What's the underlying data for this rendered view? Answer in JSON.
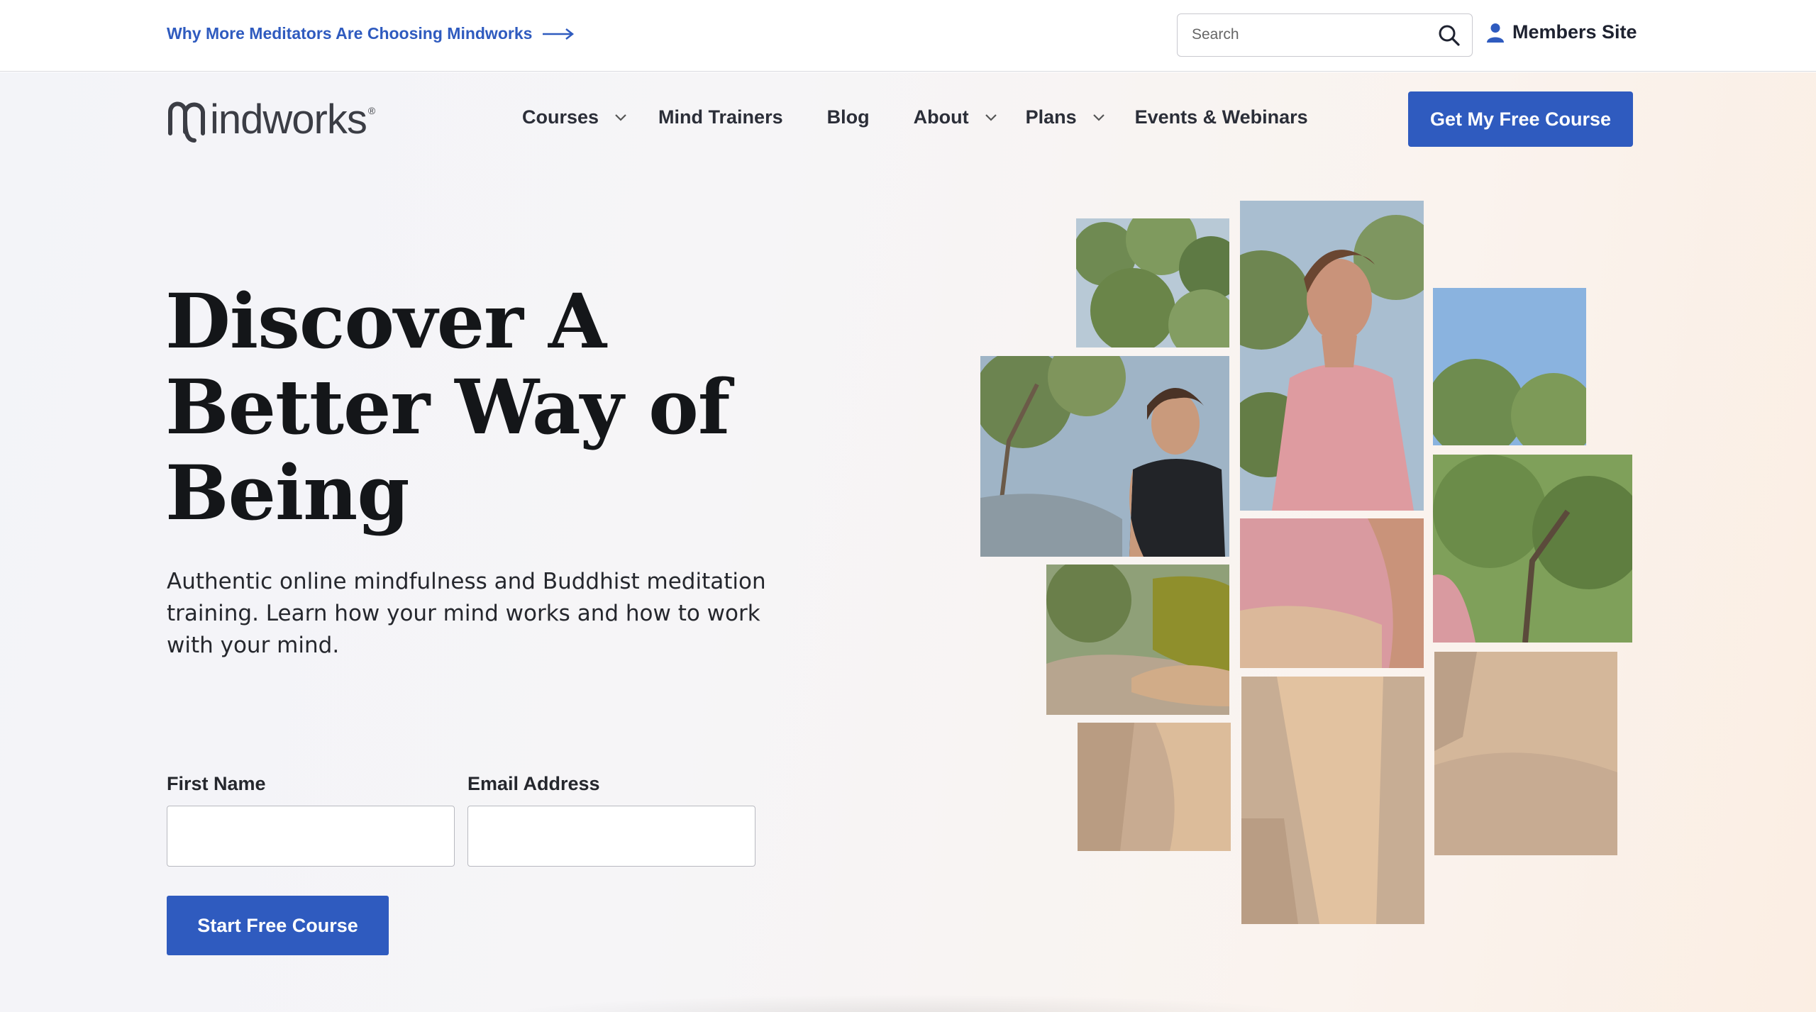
{
  "topbar": {
    "promo_text": "Why More Meditators Are Choosing Mindworks",
    "search_placeholder": "Search",
    "members_label": "Members Site"
  },
  "nav": {
    "logo_text": "indworks",
    "logo_mark": "®",
    "items": [
      {
        "label": "Courses",
        "has_dropdown": true
      },
      {
        "label": "Mind Trainers",
        "has_dropdown": false
      },
      {
        "label": "Blog",
        "has_dropdown": false
      },
      {
        "label": "About",
        "has_dropdown": true
      },
      {
        "label": "Plans",
        "has_dropdown": true
      },
      {
        "label": "Events & Webinars",
        "has_dropdown": false
      }
    ],
    "cta_label": "Get My Free Course"
  },
  "hero": {
    "headline_lines": [
      "Discover A",
      "Better Way of",
      "Being"
    ],
    "subtext": "Authentic online mindfulness and Buddhist meditation training. Learn how your mind works and how to work with your mind.",
    "first_name_label": "First Name",
    "email_label": "Email Address",
    "first_name_value": "",
    "email_value": "",
    "submit_label": "Start Free Course"
  },
  "colors": {
    "brand_blue": "#2f5bbf",
    "text_dark": "#141619"
  }
}
